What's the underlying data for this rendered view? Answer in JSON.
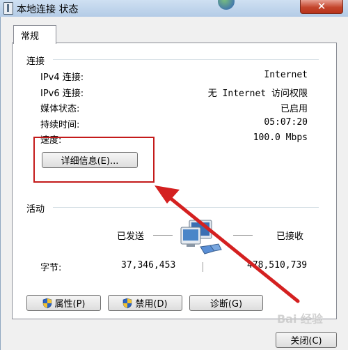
{
  "window": {
    "title": "本地连接 状态",
    "close_label": "✕"
  },
  "tabs": [
    {
      "label": "常规"
    }
  ],
  "connection": {
    "group_label": "连接",
    "rows": [
      {
        "label": "IPv4 连接:",
        "value": "Internet"
      },
      {
        "label": "IPv6 连接:",
        "value": "无 Internet 访问权限"
      },
      {
        "label": "媒体状态:",
        "value": "已启用"
      },
      {
        "label": "持续时间:",
        "value": "05:07:20"
      },
      {
        "label": "速度:",
        "value": "100.0 Mbps"
      }
    ],
    "details_button": "详细信息(E)..."
  },
  "activity": {
    "group_label": "活动",
    "sent_label": "已发送",
    "received_label": "已接收",
    "bytes_label": "字节:",
    "bytes_sent": "37,346,453",
    "bytes_received": "478,510,739"
  },
  "buttons": {
    "properties": "属性(P)",
    "disable": "禁用(D)",
    "diagnose": "诊断(G)",
    "close": "关闭(C)"
  },
  "watermark": "Bai 经验",
  "colors": {
    "highlight": "#c41a1a",
    "arrow": "#d42020"
  }
}
